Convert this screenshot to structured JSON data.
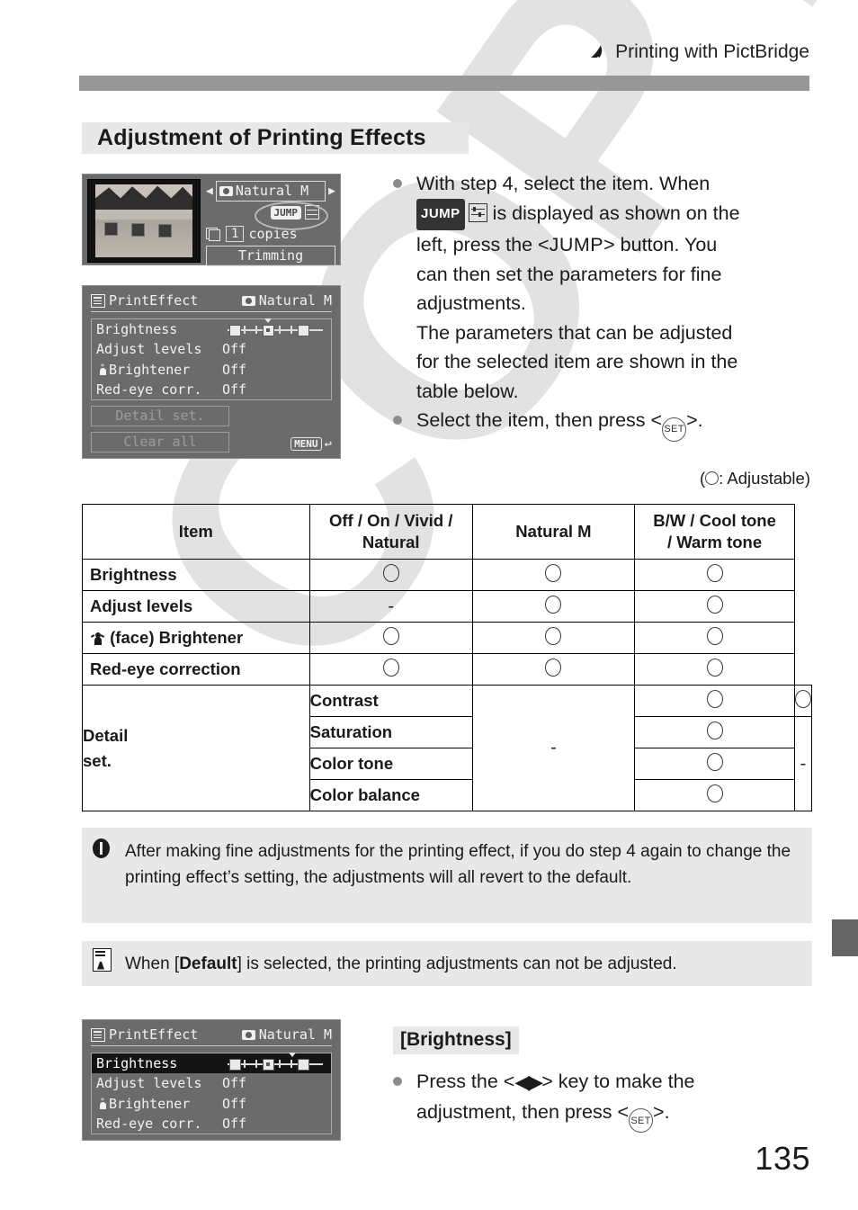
{
  "header": {
    "chapter_icon": "printer-icon",
    "chapter_title": "Printing with PictBridge"
  },
  "section": {
    "title": "Adjustment of Printing Effects"
  },
  "lcd_print_screen": {
    "effect_value": "Natural M",
    "arrow_left": "◀",
    "arrow_right": "▶",
    "jump_badge": "JUMP",
    "copies_count": "1",
    "copies_label": "copies",
    "trimming_label": "Trimming"
  },
  "lcd_print_effect": {
    "title": "PrintEffect",
    "mode": "Natural M",
    "rows": [
      {
        "label": "Brightness",
        "value": ""
      },
      {
        "label": "Adjust levels",
        "value": "Off"
      },
      {
        "label": "Brightener",
        "value": "Off"
      },
      {
        "label": "Red-eye corr.",
        "value": "Off"
      }
    ],
    "detail_button": "Detail set.",
    "clear_button": "Clear all",
    "menu_badge": "MENU",
    "return_glyph": "↩"
  },
  "body": {
    "bullet1_line1": "With step 4, select the item. When",
    "bullet1_mid": "is displayed as shown on the",
    "bullet1_line3a": "left, press the <",
    "bullet1_jump": "JUMP",
    "bullet1_line3b": "> button. You",
    "bullet1_line4": "can then set the parameters for fine",
    "bullet1_line5": "adjustments.",
    "bullet1_line6": "The parameters that can be adjusted",
    "bullet1_line7": "for the selected item are shown in the",
    "bullet1_line8": "table below.",
    "bullet2_a": "Select the item, then press <",
    "set_label": "SET",
    "bullet2_b": ">."
  },
  "legend": {
    "prefix": "(",
    "suffix": ": Adjustable)"
  },
  "table": {
    "headers": [
      "Item",
      "Off / On / Vivid /\nNatural",
      "Natural M",
      "B/W / Cool tone\n/ Warm tone"
    ],
    "header_col1": "Item",
    "header_col2_line1": "Off / On / Vivid /",
    "header_col2_line2": "Natural",
    "header_col3": "Natural M",
    "header_col4_line1": "B/W / Cool tone",
    "header_col4_line2": "/ Warm tone",
    "rows": [
      {
        "item": "Brightness",
        "col2": "O",
        "col3": "O",
        "col4": "O"
      },
      {
        "item": "Adjust levels",
        "col2": "-",
        "col3": "O",
        "col4": "O"
      },
      {
        "item": "(face) Brightener",
        "col2": "O",
        "col3": "O",
        "col4": "O"
      },
      {
        "item": "Red-eye correction",
        "col2": "O",
        "col3": "O",
        "col4": "O"
      }
    ],
    "detail_group_label_line1": "Detail",
    "detail_group_label_line2": "set.",
    "detail_col2_value": "-",
    "detail_col4_value": "-",
    "detail_rows": [
      {
        "item": "Contrast",
        "col3": "O",
        "col4": "O"
      },
      {
        "item": "Saturation",
        "col3": "O",
        "col4": ""
      },
      {
        "item": "Color tone",
        "col3": "O",
        "col4": ""
      },
      {
        "item": "Color balance",
        "col3": "O",
        "col4": ""
      }
    ]
  },
  "note_warning": {
    "icon": "exclamation-icon",
    "text": "After making fine adjustments for the printing effect, if you do step 4 again to change the printing effect’s setting, the adjustments will all revert to the default."
  },
  "note_info": {
    "icon": "note-icon",
    "text_a": "When [",
    "text_bold": "Default",
    "text_b": "] is selected, the printing adjustments can not be adjusted."
  },
  "brightness_section": {
    "title": "[Brightness]",
    "line_a": "Press the <",
    "arrows": "◀▶",
    "line_b": "> key to make the",
    "line_c": "adjustment, then press <",
    "set_label": "SET",
    "line_d": ">."
  },
  "footer": {
    "page_number": "135"
  },
  "watermark": {
    "text": "COPY"
  },
  "colors": {
    "head_bar": "#979797",
    "title_bg": "#e8e8e8",
    "note_bg": "#e8e8e8",
    "lcd_bg": "#6b6b6b",
    "side_tab": "#666666",
    "watermark": "#e2e2e2"
  }
}
